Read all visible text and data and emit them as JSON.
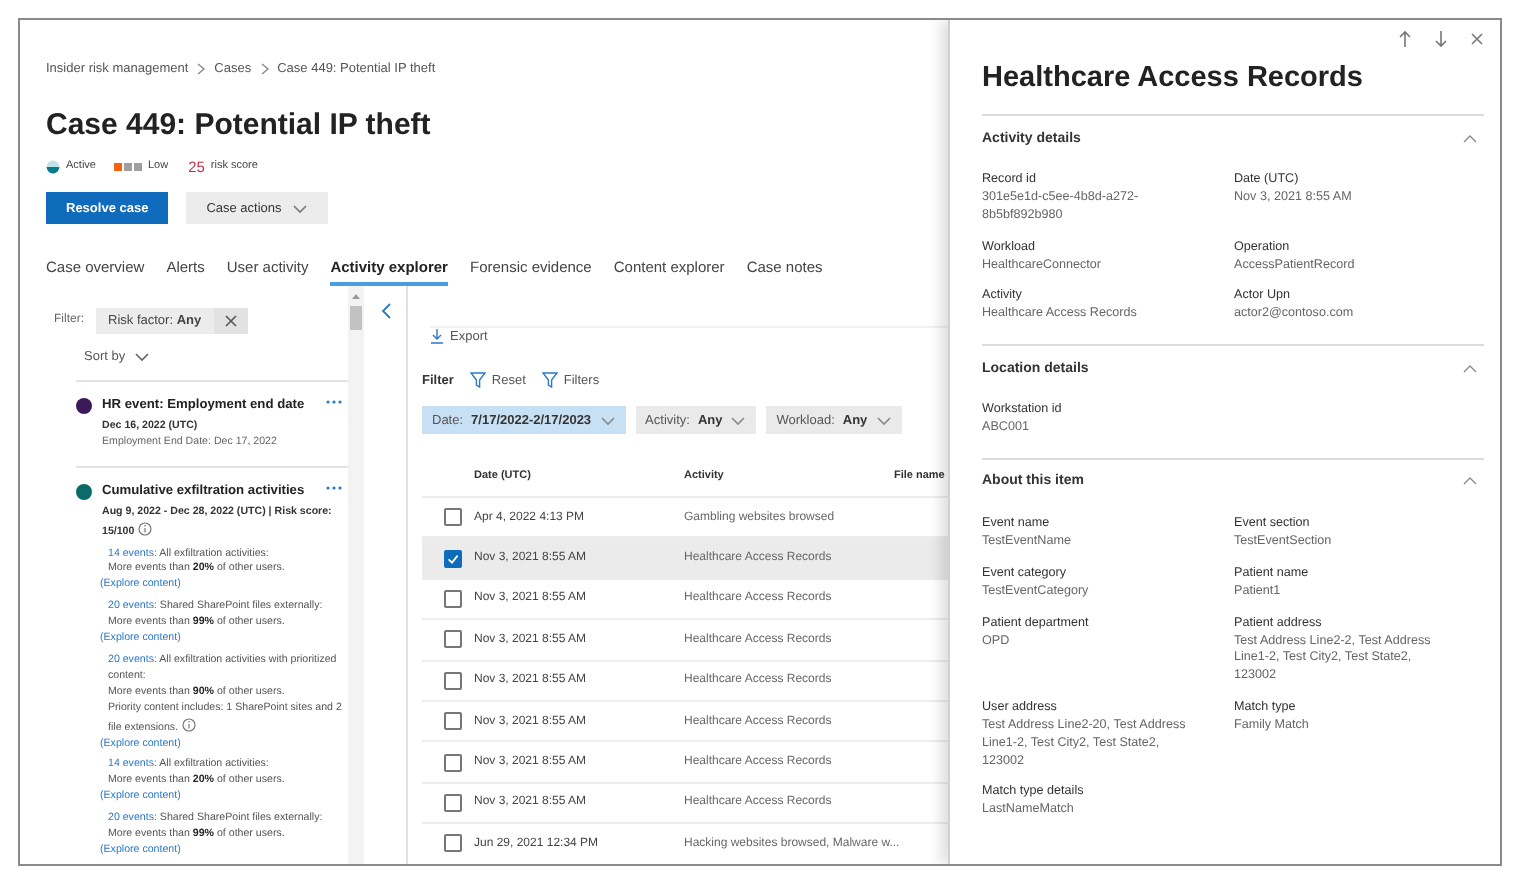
{
  "breadcrumb": [
    "Insider risk management",
    "Cases",
    "Case 449: Potential IP theft"
  ],
  "title": "Case 449: Potential IP theft",
  "status": {
    "state": "Active",
    "severity": "Low",
    "risk_score": "25",
    "risk_label": "risk score"
  },
  "buttons": [
    {
      "label": "Resolve case",
      "kind": "primary"
    },
    {
      "label": "Case actions",
      "kind": "menu"
    }
  ],
  "tabs": [
    {
      "label": "Case overview",
      "selected": false
    },
    {
      "label": "Alerts",
      "selected": false
    },
    {
      "label": "User activity",
      "selected": false
    },
    {
      "label": "Activity explorer",
      "selected": true
    },
    {
      "label": "Forensic evidence",
      "selected": false
    },
    {
      "label": "Content explorer",
      "selected": false
    },
    {
      "label": "Case notes",
      "selected": false
    }
  ],
  "alerts_pane": {
    "filter_label": "Filter:",
    "filter_chip": "Risk factor: **Any**",
    "sort": "Sort by",
    "items": [
      {
        "title": "HR event: Employment end date",
        "color": "#3b1a5a",
        "date": "Dec 16, 2022 (UTC)",
        "detail": "Employment End Date: Dec 17, 2022"
      },
      {
        "title": "Cumulative exfiltration activities",
        "color": "#0b6a6a",
        "date": "Aug 9, 2022 - Dec 28, 2022 (UTC) | Risk score: 15/100",
        "info": true,
        "events": [
          {
            "count": "14 events:",
            "description": "All exfiltration activities:",
            "detail": "More events than **20%** of other users.",
            "link": "(Explore content)"
          },
          {
            "count": "20 events:",
            "description": "Shared SharePoint files externally:",
            "detail": "More events than **99%** of other users.",
            "link": "(Explore content)"
          },
          {
            "count": "20 events:",
            "description": "All exfiltration activities with prioritized content:",
            "detail": "More events than **90%** of other users.",
            "note": "Priority content includes: 1 SharePoint sites and 2 file extensions.",
            "info": true,
            "link": "(Explore content)"
          },
          {
            "count": "14 events:",
            "description": "All exfiltration activities:",
            "detail": "More events than **20%** of other users.",
            "link": "(Explore content)"
          },
          {
            "count": "20 events:",
            "description": "Shared SharePoint files externally:",
            "detail": "More events than **99%** of other users.",
            "link": "(Explore content)"
          }
        ]
      }
    ]
  },
  "explorer": {
    "export": "Export",
    "filter_label": "Filter",
    "reset": "Reset",
    "filters": "Filters",
    "chips": [
      {
        "label": "Date:",
        "value": "7/17/2022-2/17/2023",
        "selected": true
      },
      {
        "label": "Activity:",
        "value": "Any",
        "selected": false
      },
      {
        "label": "Workload:",
        "value": "Any",
        "selected": false
      }
    ],
    "columns": [
      "Date (UTC)",
      "Activity",
      "File name"
    ],
    "rows": [
      {
        "date": "Apr 4, 2022 4:13 PM",
        "activity": "Gambling websites browsed",
        "selected": false
      },
      {
        "date": "Nov 3, 2021 8:55 AM",
        "activity": "Healthcare Access Records",
        "selected": true
      },
      {
        "date": "Nov 3, 2021 8:55 AM",
        "activity": "Healthcare Access Records",
        "selected": false
      },
      {
        "date": "Nov 3, 2021 8:55 AM",
        "activity": "Healthcare Access Records",
        "selected": false
      },
      {
        "date": "Nov 3, 2021 8:55 AM",
        "activity": "Healthcare Access Records",
        "selected": false
      },
      {
        "date": "Nov 3, 2021 8:55 AM",
        "activity": "Healthcare Access Records",
        "selected": false
      },
      {
        "date": "Nov 3, 2021 8:55 AM",
        "activity": "Healthcare Access Records",
        "selected": false
      },
      {
        "date": "Nov 3, 2021 8:55 AM",
        "activity": "Healthcare Access Records",
        "selected": false
      },
      {
        "date": "Jun 29, 2021 12:34 PM",
        "activity": "Hacking websites browsed, Malware w...",
        "selected": false
      }
    ]
  },
  "details": {
    "title": "Healthcare Access Records",
    "sections": [
      {
        "title": "Activity details",
        "expanded": true,
        "fields": [
          {
            "label": "Record id",
            "value": "301e5e1d-c5ee-4b8d-a272-8b5bf892b980"
          },
          {
            "label": "Date (UTC)",
            "value": "Nov 3, 2021 8:55 AM"
          },
          {
            "label": "Workload",
            "value": "HealthcareConnector"
          },
          {
            "label": "Operation",
            "value": "AccessPatientRecord"
          },
          {
            "label": "Activity",
            "value": "Healthcare Access Records"
          },
          {
            "label": "Actor Upn",
            "value": "actor2@contoso.com"
          }
        ]
      },
      {
        "title": "Location details",
        "expanded": true,
        "fields": [
          {
            "label": "Workstation id",
            "value": "ABC001"
          }
        ]
      },
      {
        "title": "About this item",
        "expanded": true,
        "fields": [
          {
            "label": "Event name",
            "value": "TestEventName"
          },
          {
            "label": "Event section",
            "value": "TestEventSection"
          },
          {
            "label": "Event category",
            "value": "TestEventCategory"
          },
          {
            "label": "Patient name",
            "value": "Patient1"
          },
          {
            "label": "Patient department",
            "value": "OPD"
          },
          {
            "label": "Patient address",
            "value": "Test Address Line2-2, Test Address Line1-2, Test City2, Test State2, 123002"
          },
          {
            "label": "User address",
            "value": "Test Address Line2-20, Test Address Line1-2, Test City2, Test State2, 123002"
          },
          {
            "label": "Match type",
            "value": "Family Match"
          },
          {
            "label": "Match type details",
            "value": "LastNameMatch"
          }
        ]
      }
    ]
  }
}
